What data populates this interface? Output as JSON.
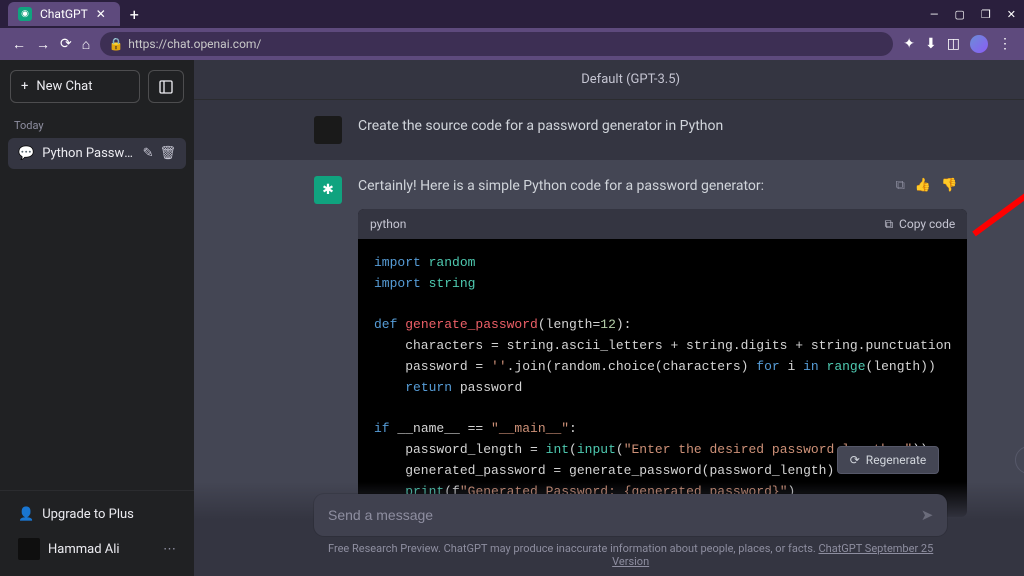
{
  "browser": {
    "tab_title": "ChatGPT",
    "url": "https://chat.openai.com/"
  },
  "sidebar": {
    "new_chat": "New Chat",
    "section_label": "Today",
    "chat_item_title": "Python Password Gene",
    "upgrade": "Upgrade to Plus",
    "user_name": "Hammad Ali"
  },
  "header": {
    "model": "Default (GPT-3.5)"
  },
  "user_msg": "Create the source code for a password generator in Python",
  "assistant_intro": "Certainly! Here is a simple Python code for a password generator:",
  "code": {
    "lang": "python",
    "copy_label": "Copy code",
    "line1_kw1": "import",
    "line1_mod": "random",
    "line2_kw1": "import",
    "line2_mod": "string",
    "line3_kw": "def",
    "line3_fn": "generate_password",
    "line3_param": "(length=",
    "line3_num": "12",
    "line3_close": "):",
    "line4": "    characters = string.ascii_letters + string.digits + string.punctuation",
    "line5a": "    password = ",
    "line5str": "''",
    "line5b": ".join(random.choice(characters) ",
    "line5for": "for",
    "line5c": " i ",
    "line5in": "in",
    "line5d": " ",
    "line5range": "range",
    "line5e": "(length))",
    "line6_kw": "return",
    "line6_rest": " password",
    "line7_if": "if",
    "line7_a": " __name__ == ",
    "line7_str": "\"__main__\"",
    "line7_b": ":",
    "line8_a": "    password_length = ",
    "line8_int": "int",
    "line8_b": "(",
    "line8_input": "input",
    "line8_c": "(",
    "line8_str": "\"Enter the desired password length: \"",
    "line8_d": "))",
    "line9": "    generated_password = generate_password(password_length)",
    "line10_a": "    ",
    "line10_print": "print",
    "line10_b": "(f",
    "line10_str": "\"Generated Password: {generated_password}\"",
    "line10_c": ")"
  },
  "regenerate": "Regenerate",
  "input": {
    "placeholder": "Send a message"
  },
  "disclaimer": {
    "prefix": "Free Research Preview. ChatGPT may produce inaccurate information about people, places, or facts. ",
    "link": "ChatGPT September 25 Version"
  }
}
